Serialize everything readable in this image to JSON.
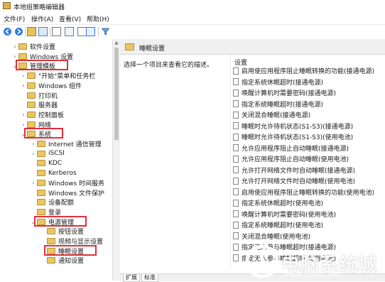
{
  "window": {
    "title": "本地组策略编辑器"
  },
  "menu": [
    "文件(F)",
    "操作(A)",
    "查看(V)",
    "帮助(H)"
  ],
  "toolbar": {
    "icons": [
      "back-arrow",
      "forward-arrow",
      "folder-up",
      "show-hide-tree",
      "properties",
      "export-list",
      "help",
      "extended-view",
      "filter"
    ]
  },
  "tree": [
    {
      "label": "软件设置",
      "indent": 1,
      "chevron": "›",
      "highlight": false
    },
    {
      "label": "Windows 设置",
      "indent": 1,
      "chevron": "›",
      "highlight": false
    },
    {
      "label": "管理模板",
      "indent": 1,
      "chevron": "⌄",
      "highlight": true
    },
    {
      "label": "\"开始\"菜单和任务栏",
      "indent": 2,
      "chevron": "›",
      "highlight": false
    },
    {
      "label": "Windows 组件",
      "indent": 2,
      "chevron": "›",
      "highlight": false
    },
    {
      "label": "打印机",
      "indent": 2,
      "chevron": "",
      "highlight": false
    },
    {
      "label": "服务器",
      "indent": 2,
      "chevron": "",
      "highlight": false
    },
    {
      "label": "控制面板",
      "indent": 2,
      "chevron": "›",
      "highlight": false
    },
    {
      "label": "网络",
      "indent": 2,
      "chevron": "›",
      "highlight": false
    },
    {
      "label": "系统",
      "indent": 2,
      "chevron": "⌄",
      "highlight": true
    },
    {
      "label": "Internet 通信管理",
      "indent": 3,
      "chevron": "›",
      "highlight": false
    },
    {
      "label": "iSCSI",
      "indent": 3,
      "chevron": "›",
      "highlight": false
    },
    {
      "label": "KDC",
      "indent": 3,
      "chevron": "",
      "highlight": false
    },
    {
      "label": "Kerberos",
      "indent": 3,
      "chevron": "",
      "highlight": false
    },
    {
      "label": "Windows 时间服务",
      "indent": 3,
      "chevron": "›",
      "highlight": false
    },
    {
      "label": "Windows 文件保护",
      "indent": 3,
      "chevron": "",
      "highlight": false
    },
    {
      "label": "设备配额",
      "indent": 3,
      "chevron": "",
      "highlight": false
    },
    {
      "label": "登录",
      "indent": 3,
      "chevron": "",
      "highlight": false
    },
    {
      "label": "电源管理",
      "indent": 3,
      "chevron": "⌄",
      "highlight": true
    },
    {
      "label": "按钮设置",
      "indent": 4,
      "chevron": "",
      "highlight": false
    },
    {
      "label": "视频与显示设置",
      "indent": 4,
      "chevron": "",
      "highlight": false
    },
    {
      "label": "睡眠设置",
      "indent": 4,
      "chevron": "",
      "highlight": true
    },
    {
      "label": "通知设置",
      "indent": 4,
      "chevron": "",
      "highlight": false
    }
  ],
  "right": {
    "header_title": "睡眠设置",
    "description": "选择一个项目来查看它的描述。",
    "column_header": "设置",
    "settings": [
      "启用使应用程序阻止睡眠转换的功能(接通电源)",
      "指定系统休眠超时(接通电源)",
      "唤醒计算机时需要密码(接通电源)",
      "指定系统睡眠超时(接通电源)",
      "关闭混合睡眠(接通电源)",
      "睡眠时允许待机状态(S1-S3)(接通电源)",
      "睡眠时允许待机状态(S1-S3)(使用电池)",
      "允许应用程序阻止自动睡眠(接通电源)",
      "允许应用程序阻止自动睡眠(使用电池)",
      "允许打开网络文件时自动睡眠(接通电源)",
      "允许打开网络文件时自动睡眠(使用电池)",
      "启用使应用程序阻止睡眠转换的功能(使用电池)",
      "指定系统休眠超时(使用电池)",
      "唤醒计算机时需要密码(使用电池)",
      "指定系统睡眠超时(使用电池)",
      "关闭混合睡眠(使用电池)",
      "指定无人参与睡眠超时(接通电源)",
      "指定无人参与睡眠超时(使用电池)"
    ],
    "tabs": [
      "扩展",
      "标准"
    ]
  }
}
